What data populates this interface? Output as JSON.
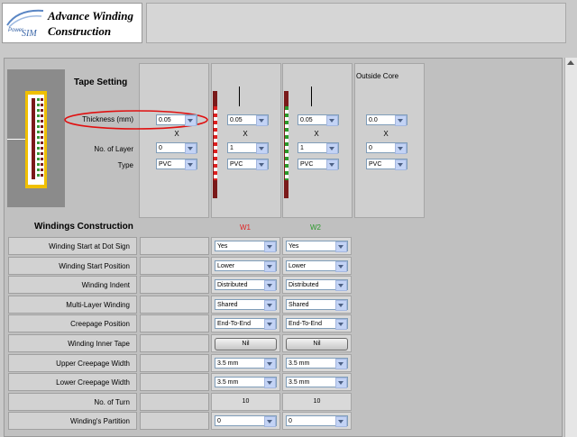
{
  "app": {
    "logo_power": "Power",
    "logo_sim": "SIM",
    "title_line1": "Advance Winding",
    "title_line2": "Construction"
  },
  "tape": {
    "title": "Tape Setting",
    "outside_core": "Outside Core",
    "thickness_label": "Thickness (mm)",
    "layer_label": "No. of Layer",
    "type_label": "Type",
    "x": "X",
    "columns": [
      {
        "thickness": "0.05",
        "layer": "0",
        "type": "PVC"
      },
      {
        "thickness": "0.05",
        "layer": "1",
        "type": "PVC"
      },
      {
        "thickness": "0.05",
        "layer": "1",
        "type": "PVC"
      },
      {
        "thickness": "0.0",
        "layer": "0",
        "type": "PVC"
      }
    ]
  },
  "windings": {
    "title": "Windings Construction",
    "w1": {
      "name": "W1",
      "color": "#e02020"
    },
    "w2": {
      "name": "W2",
      "color": "#2a9a2a"
    },
    "rows": [
      {
        "label": "Winding Start at Dot Sign",
        "w1": "Yes",
        "w2": "Yes",
        "kind": "select"
      },
      {
        "label": "Winding Start Position",
        "w1": "Lower",
        "w2": "Lower",
        "kind": "select"
      },
      {
        "label": "Winding Indent",
        "w1": "Distributed",
        "w2": "Distributed",
        "kind": "select"
      },
      {
        "label": "Multi-Layer Winding",
        "w1": "Shared",
        "w2": "Shared",
        "kind": "select"
      },
      {
        "label": "Creepage Position",
        "w1": "End-To-End",
        "w2": "End-To-End",
        "kind": "select"
      },
      {
        "label": "Winding Inner Tape",
        "w1": "Nil",
        "w2": "Nil",
        "kind": "button"
      },
      {
        "label": "Upper Creepage Width",
        "w1": "3.5 mm",
        "w2": "3.5 mm",
        "kind": "select"
      },
      {
        "label": "Lower Creepage Width",
        "w1": "3.5 mm",
        "w2": "3.5 mm",
        "kind": "select"
      },
      {
        "label": "No. of Turn",
        "w1": "10",
        "w2": "10",
        "kind": "value"
      },
      {
        "label": "Winding's Partition",
        "w1": "0",
        "w2": "0",
        "kind": "select"
      }
    ]
  },
  "colors": {
    "highlight_ellipse": "#e01010",
    "bobbin": "#f0c000",
    "winding_bar": "#7a1a1a"
  }
}
